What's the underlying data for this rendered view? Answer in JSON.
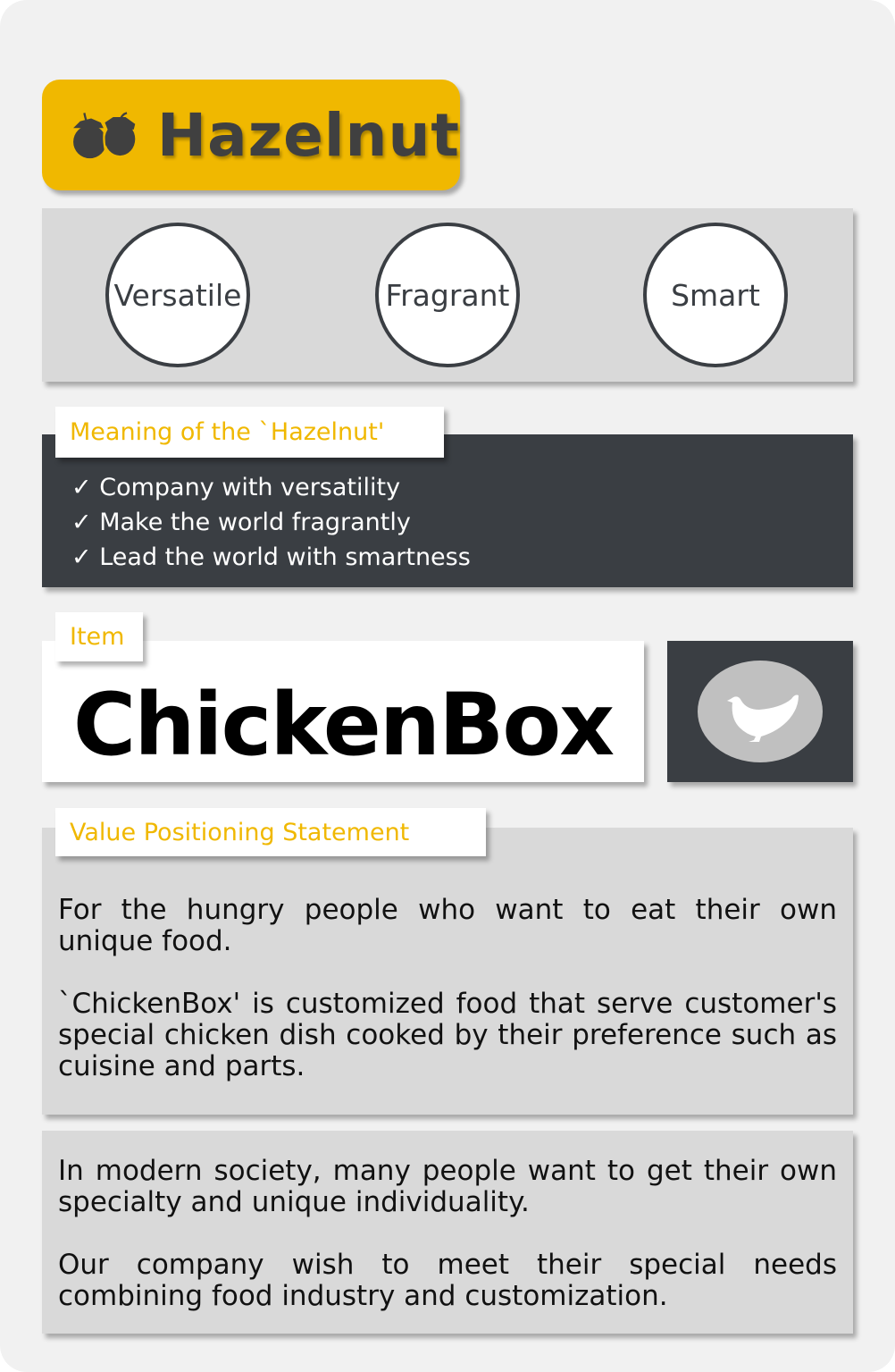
{
  "brand": {
    "name": "Hazelnut",
    "icon": "acorn-icon"
  },
  "traits": [
    "Versatile",
    "Fragrant",
    "Smart"
  ],
  "meaning": {
    "label": "Meaning of the `Hazelnut'",
    "items": [
      "Company with versatility",
      "Make the world fragrantly",
      "Lead the world with smartness"
    ],
    "check": "✓"
  },
  "item": {
    "label": "Item",
    "name": "ChickenBox",
    "icon": "chicken-icon"
  },
  "vps": {
    "label": "Value Positioning Statement",
    "paragraphs": [
      "For the hungry people who want to eat their own unique food.",
      "`ChickenBox' is customized food that serve customer's special chicken dish cooked by their preference such as cuisine and parts."
    ]
  },
  "mission": {
    "paragraphs": [
      "In modern society, many people want to get their own specialty and unique individuality.",
      "Our company wish to meet their special needs combining food industry and customization."
    ]
  },
  "colors": {
    "accent": "#f0b800",
    "dark": "#3a3e43",
    "panel": "#d9d9d9"
  }
}
